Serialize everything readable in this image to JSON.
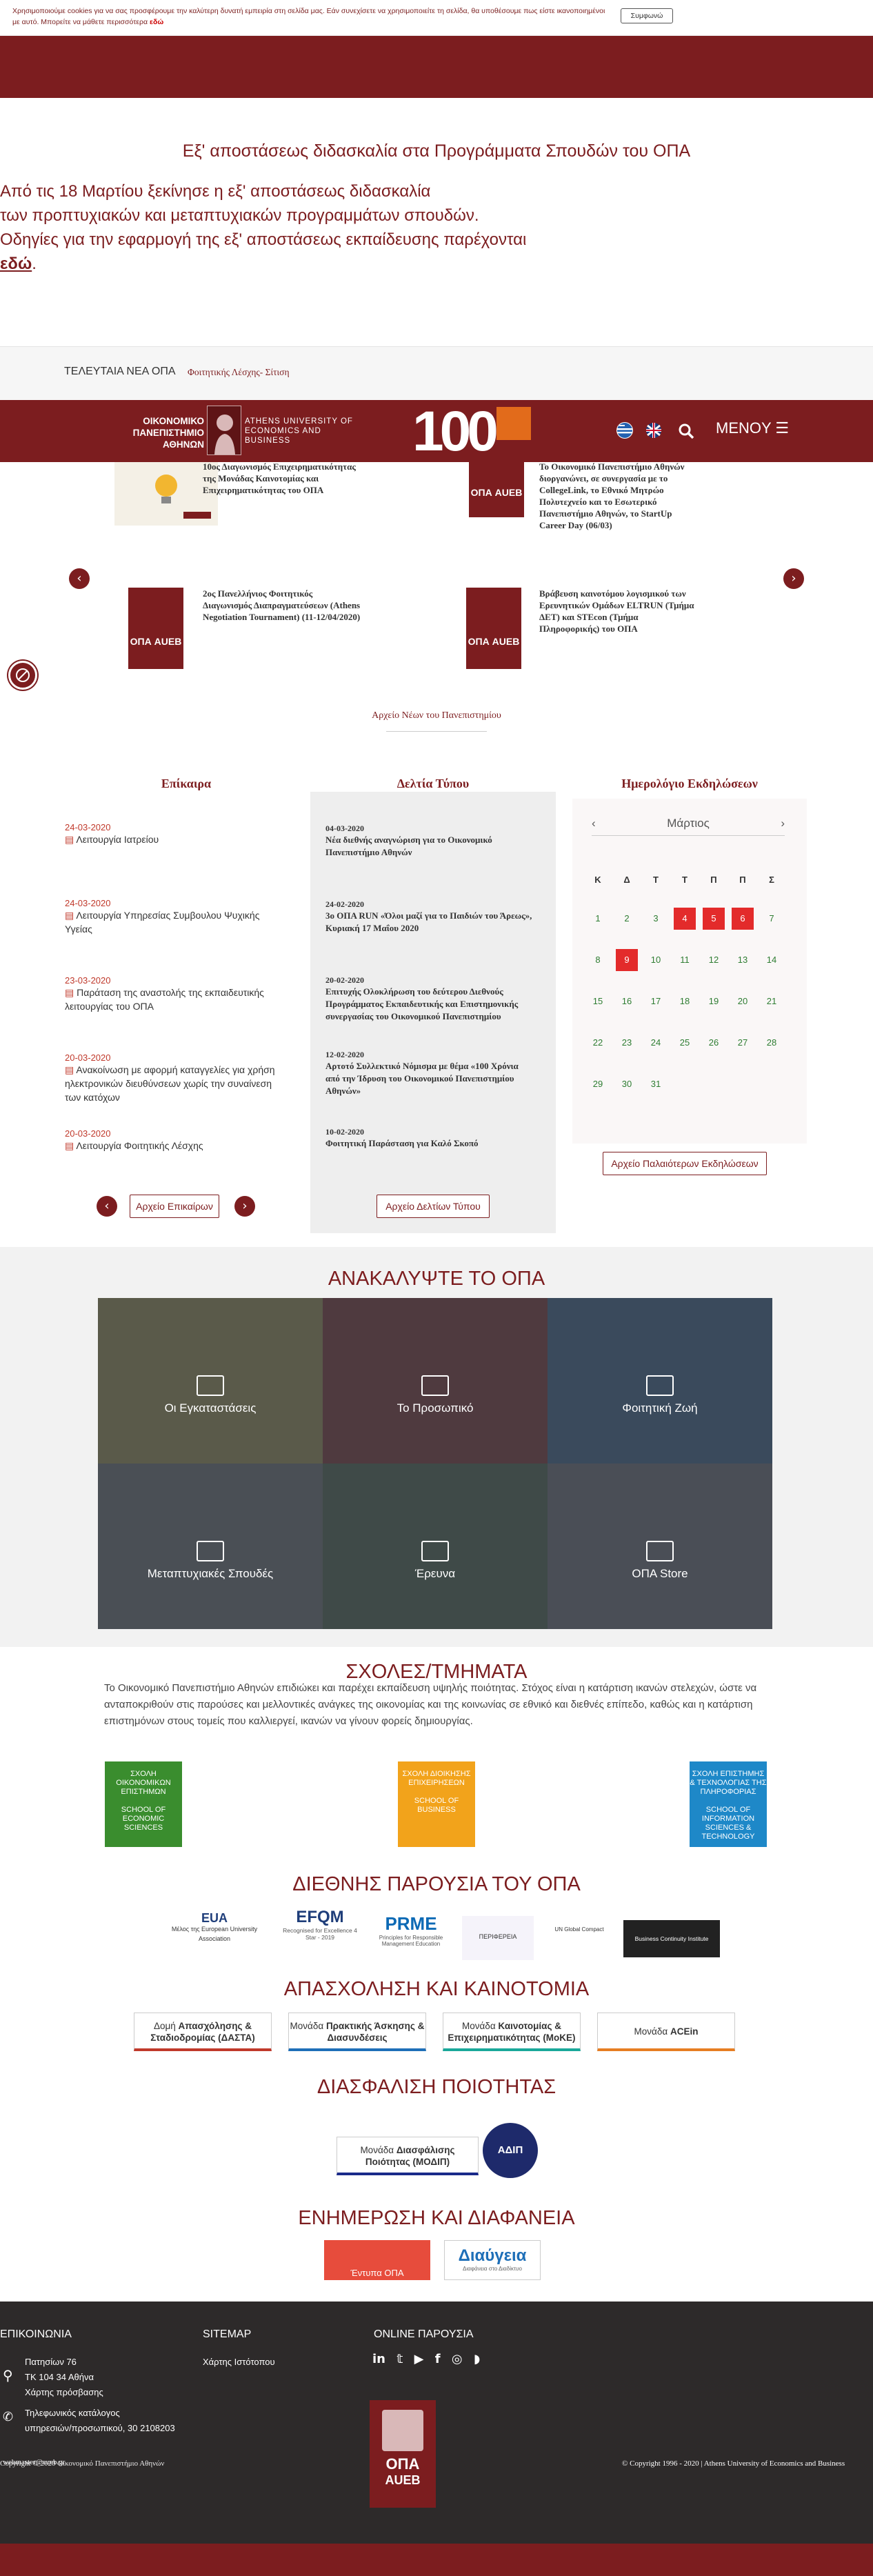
{
  "cookie": {
    "text": "Χρησιμοποιούμε cookies για να σας προσφέρουμε την καλύτερη δυνατή εμπειρία στη σελίδα μας. Εάν συνεχίσετε να χρησιμοποιείτε τη σελίδα, θα υποθέσουμε πως είστε ικανοποιημένοι με αυτό. Μπορείτε να μάθετε περισσότερα",
    "link": "εδώ",
    "accept_label": "Συμφωνώ"
  },
  "notice": {
    "title": "Εξ' αποστάσεως διδασκαλία στα Προγράμματα Σπουδών του ΟΠΑ",
    "line1": "Από τις 18 Μαρτίου ξεκίνησε η εξ' αποστάσεως διδασκαλία",
    "line2": "των προπτυχιακών και μεταπτυχιακών προγραμμάτων σπουδών.",
    "line3": "Οδηγίες για την εφαρμογή της εξ' αποστάσεως εκπαίδευσης παρέχονται",
    "link": "εδώ",
    "link_suffix": "."
  },
  "ticker": {
    "label": "ΤΕΛΕΥΤΑΙΑ ΝΕΑ ΟΠΑ",
    "item": "Φοιτητικής Λέσχης- Σίτιση"
  },
  "header": {
    "logo_gr": "ΟΙΚΟΝΟΜΙΚΟ ΠΑΝΕΠΙΣΤΗΜΙΟ ΑΘΗΝΩΝ",
    "logo_en": "ATHENS UNIVERSITY OF ECONOMICS AND BUSINESS",
    "centennial": "100",
    "menu_label": "MENOY"
  },
  "news": [
    {
      "title": "10ος Διαγωνισμός Επιχειρηματικότητας της Μονάδας Καινοτομίας και Επιχειρηματικότητας του ΟΠΑ",
      "thumb": "idea"
    },
    {
      "title": "Το Οικονομικό Πανεπιστήμιο Αθηνών διοργανώνει, σε συνεργασία με το CollegeLink, το Εθνικό Μητρώο Πολυτεχνείο και το Εσωτερικό Πανεπιστήμιο Αθηνών, το StartUp Career Day (06/03)",
      "thumb": "ΟΠΑ AUEB"
    },
    {
      "title": "2ος Πανελλήνιος Φοιτητικός Διαγωνισμός Διαπραγματεύσεων (Athens Negotiation Tournament) (11-12/04/2020)",
      "thumb": "ΟΠΑ AUEB"
    },
    {
      "title": "Βράβευση καινοτόμου λογισμικού των Ερευνητικών Ομάδων ELTRUN (Τμήμα ΔΕΤ) και STEcon (Τμήμα Πληροφορικής) του ΟΠΑ",
      "thumb": "ΟΠΑ AUEB"
    }
  ],
  "news_archive": "Αρχείο Νέων του Πανεπιστημίου",
  "announcements": {
    "heading": "Επίκαιρα",
    "items": [
      {
        "date": "24-03-2020",
        "title": "Λειτουργία Ιατρείου"
      },
      {
        "date": "24-03-2020",
        "title": "Λειτουργία Υπηρεσίας Συμβουλου Ψυχικής Υγείας"
      },
      {
        "date": "23-03-2020",
        "title": "Παράταση της αναστολής της εκπαιδευτικής λειτουργίας του ΟΠΑ"
      },
      {
        "date": "20-03-2020",
        "title": "Ανακοίνωση με αφορμή καταγγελίες για χρήση ηλεκτρονικών διευθύνσεων χωρίς την συναίνεση των κατόχων"
      },
      {
        "date": "20-03-2020",
        "title": "Λειτουργία Φοιτητικής Λέσχης"
      }
    ],
    "archive_label": "Αρχείο Επικαίρων"
  },
  "press": {
    "heading": "Δελτία Τύπου",
    "items": [
      {
        "date": "04-03-2020",
        "title": "Νέα διεθνής αναγνώριση για το Οικονομικό Πανεπιστήμιο Αθηνών"
      },
      {
        "date": "24-02-2020",
        "title": "3ο ΟΠΑ RUN «Όλοι μαζί για το Παιδιών του Άρεως», Κυριακή 17 Μαΐου 2020"
      },
      {
        "date": "20-02-2020",
        "title": "Επιτυχής Ολοκλήρωση του δεύτερου Διεθνούς Προγράμματος Εκπαιδευτικής και Επιστημονικής συνεργασίας του Οικονομικού Πανεπιστημίου"
      },
      {
        "date": "12-02-2020",
        "title": "Αρτοτό Συλλεκτικό Νόμισμα με θέμα «100 Χρόνια από την Ίδρυση του Οικονομικού Πανεπιστημίου Αθηνών»"
      },
      {
        "date": "10-02-2020",
        "title": "Φοιτητική Παράσταση για Καλό Σκοπό"
      }
    ],
    "archive_label": "Αρχείο Δελτίων Τύπου"
  },
  "calendar": {
    "heading": "Ημερολόγιο Εκδηλώσεων",
    "month": "Μάρτιος",
    "weekdays": [
      "Κ",
      "Δ",
      "Τ",
      "Τ",
      "Π",
      "Π",
      "Σ"
    ],
    "days": [
      "1",
      "2",
      "3",
      "4",
      "5",
      "6",
      "7",
      "8",
      "9",
      "10",
      "11",
      "12",
      "13",
      "14",
      "15",
      "16",
      "17",
      "18",
      "19",
      "20",
      "21",
      "22",
      "23",
      "24",
      "25",
      "26",
      "27",
      "28",
      "29",
      "30",
      "31"
    ],
    "highlighted": [
      "4",
      "5",
      "6",
      "9"
    ],
    "archive_label": "Αρχείο Παλαιότερων Εκδηλώσεων"
  },
  "discover": {
    "title": "ΑΝΑΚΑΛΥΨΤΕ ΤΟ ΟΠΑ",
    "tiles": [
      "Οι Εγκαταστάσεις",
      "Το Προσωπικό",
      "Φοιτητική Ζωή",
      "Μεταπτυχιακές Σπουδές",
      "Έρευνα",
      "ΟΠΑ Store"
    ]
  },
  "schools": {
    "title": "ΣΧΟΛΕΣ/ΤΜΗΜΑΤΑ",
    "intro": "Το Οικονομικό Πανεπιστήμιο Αθηνών επιδιώκει και παρέχει εκπαίδευση υψηλής ποιότητας. Στόχος είναι η κατάρτιση ικανών στελεχών, ώστε να ανταποκριθούν στις παρούσες και μελλοντικές ανάγκες της οικονομίας και της κοινωνίας σε εθνικό και διεθνές επίπεδο, καθώς και η κατάρτιση επιστημόνων στους τομείς που καλλιεργεί, ικανών να γίνουν φορείς δημιουργίας.",
    "items": [
      {
        "gr": "ΣΧΟΛΗ ΟΙΚΟΝΟΜΙΚΩΝ ΕΠΙΣΤΗΜΩΝ",
        "en": "SCHOOL OF ECONOMIC SCIENCES",
        "color": "#3a8d2e"
      },
      {
        "gr": "ΣΧΟΛΗ ΔΙΟΙΚΗΣΗΣ ΕΠΙΧΕΙΡΗΣΕΩΝ",
        "en": "SCHOOL OF BUSINESS",
        "color": "#f2a31b"
      },
      {
        "gr": "ΣΧΟΛΗ ΕΠΙΣΤΗΜΗΣ & ΤΕΧΝΟΛΟΓΙΑΣ ΤΗΣ ΠΛΗΡΟΦΟΡΙΑΣ",
        "en": "SCHOOL OF INFORMATION SCIENCES & TECHNOLOGY",
        "color": "#1e88c8"
      }
    ]
  },
  "international": {
    "title": "ΔΙΕΘΝΗΣ ΠΑΡΟΥΣΙΑ ΤΟΥ ΟΠΑ",
    "partners": [
      "EUA",
      "Μέλος της European University Association",
      "EFQM",
      "Recognised for Excellence 4 Star - 2019",
      "PRME",
      "Principles for Responsible Management Education",
      "ΠΕΡΙΦΕΡΕΙΑ",
      "UN Global Compact",
      "Business Continuity Institute"
    ]
  },
  "employment": {
    "title": "ΑΠΑΣΧΟΛΗΣΗ ΚΑΙ ΚΑΙΝΟΤΟΜΙΑ",
    "units": [
      {
        "pre": "Δομή",
        "bold": "Απασχόλησης & Σταδιοδρομίας (ΔΑΣΤΑ)",
        "color": "#c0392b"
      },
      {
        "pre": "Μονάδα",
        "bold": "Πρακτικής Άσκησης & Διασυνδέσεις",
        "color": "#1e6fb8"
      },
      {
        "pre": "Μονάδα",
        "bold": "Καινοτομίας & Επιχειρηματικότητας (ΜοΚΕ)",
        "color": "#1aa89a"
      },
      {
        "pre": "Μονάδα",
        "bold": "ACEin",
        "color": "#e67e22"
      }
    ]
  },
  "quality": {
    "title": "ΔΙΑΣΦΑΛΙΣΗ ΠΟΙΟΤΗΤΑΣ",
    "unit_pre": "Μονάδα",
    "unit_bold": "Διασφάλισης Ποιότητας (ΜΟΔΙΠ)",
    "badge": "ΑΔΙΠ"
  },
  "transparency": {
    "title": "ΕΝΗΜΕΡΩΣΗ ΚΑΙ ΔΙΑΦΑΝΕΙΑ",
    "forms": "Έντυπα ΟΠΑ",
    "diavgeia": "Διαύγεια",
    "diavgeia_sub": "Διαφάνεια στο Διαδίκτυο"
  },
  "footer": {
    "contact_heading": "ΕΠΙΚΟΙΝΩΝΙΑ",
    "address1": "Πατησίων 76",
    "address2": "ΤΚ 104 34 Αθήνα",
    "map_link": "Χάρτης πρόσβασης",
    "phone_label": "Τηλεφωνικός κατάλογος",
    "phone": "υπηρεσιών/προσωπικού, 30 2108203",
    "email": "webmaster@aueb.gr",
    "sitemap_heading": "SITEMAP",
    "sitemap_link": "Χάρτης Ιστότοπου",
    "online_heading": "ONLINE ΠΑΡΟΥΣΙΑ",
    "copyright_left": "Copyright © 2020 Οικονομικό Πανεπιστήμιο Αθηνών",
    "copyright_right": "© Copyright 1996 - 2020 | Athens University of Economics and Business",
    "logo_gr": "ΟΠΑ",
    "logo_en": "AUEB"
  }
}
